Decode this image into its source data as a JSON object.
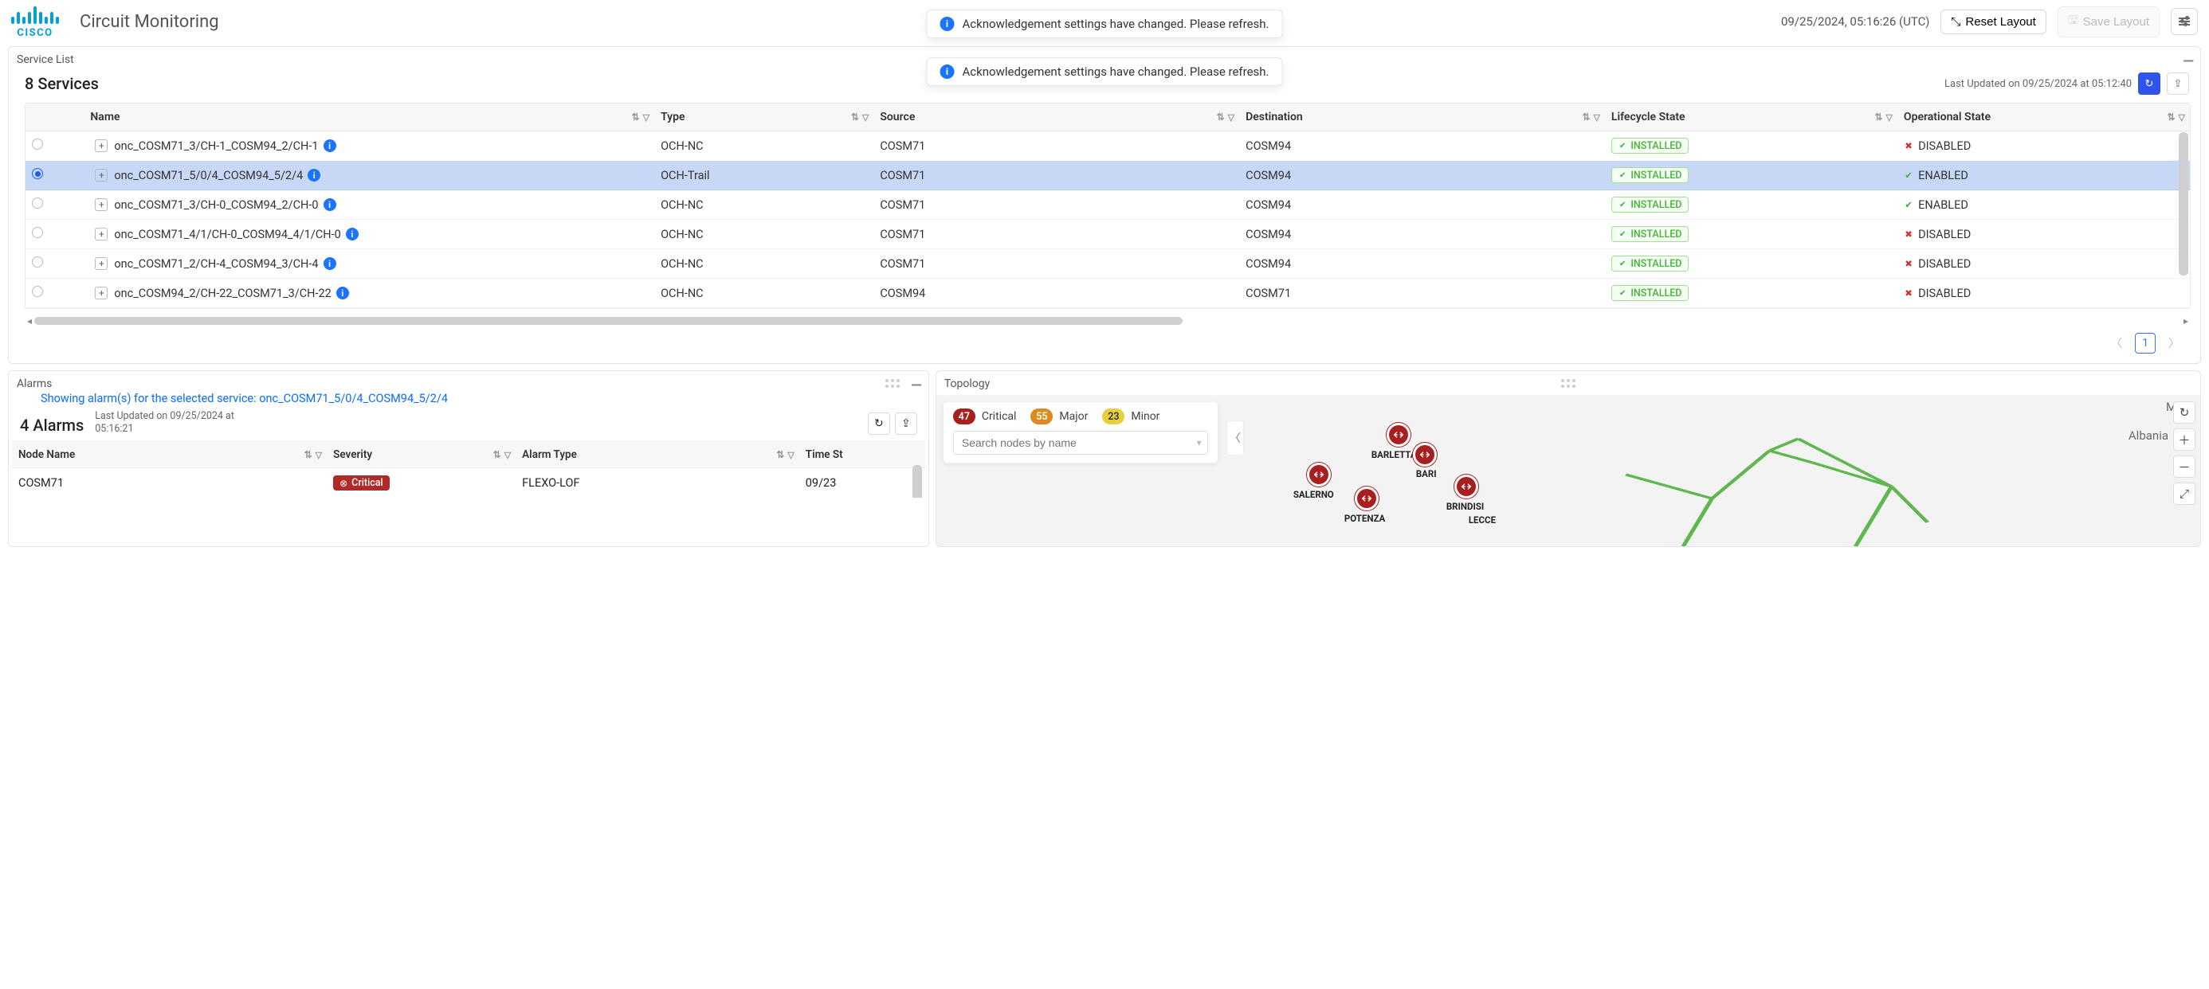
{
  "app": {
    "title": "Circuit Monitoring",
    "vendor": "cisco"
  },
  "toast": {
    "message": "Acknowledgement settings have changed. Please refresh."
  },
  "header": {
    "timestamp": "09/25/2024, 05:16:26 (UTC)",
    "reset_label": "Reset Layout",
    "save_label": "Save Layout"
  },
  "service_list": {
    "panel_title": "Service List",
    "count_label": "8 Services",
    "last_updated": "Last Updated on 09/25/2024 at 05:12:40",
    "columns": {
      "name": "Name",
      "type": "Type",
      "source": "Source",
      "destination": "Destination",
      "lifecycle": "Lifecycle State",
      "operational": "Operational State"
    },
    "rows": [
      {
        "selected": false,
        "name": "onc_COSM71_3/CH-1_COSM94_2/CH-1",
        "type": "OCH-NC",
        "source": "COSM71",
        "destination": "COSM94",
        "lifecycle": "INSTALLED",
        "operational": "DISABLED",
        "op_ok": false
      },
      {
        "selected": true,
        "name": "onc_COSM71_5/0/4_COSM94_5/2/4",
        "type": "OCH-Trail",
        "source": "COSM71",
        "destination": "COSM94",
        "lifecycle": "INSTALLED",
        "operational": "ENABLED",
        "op_ok": true
      },
      {
        "selected": false,
        "name": "onc_COSM71_3/CH-0_COSM94_2/CH-0",
        "type": "OCH-NC",
        "source": "COSM71",
        "destination": "COSM94",
        "lifecycle": "INSTALLED",
        "operational": "ENABLED",
        "op_ok": true
      },
      {
        "selected": false,
        "name": "onc_COSM71_4/1/CH-0_COSM94_4/1/CH-0",
        "type": "OCH-NC",
        "source": "COSM71",
        "destination": "COSM94",
        "lifecycle": "INSTALLED",
        "operational": "DISABLED",
        "op_ok": false
      },
      {
        "selected": false,
        "name": "onc_COSM71_2/CH-4_COSM94_3/CH-4",
        "type": "OCH-NC",
        "source": "COSM71",
        "destination": "COSM94",
        "lifecycle": "INSTALLED",
        "operational": "DISABLED",
        "op_ok": false
      },
      {
        "selected": false,
        "name": "onc_COSM94_2/CH-22_COSM71_3/CH-22",
        "type": "OCH-NC",
        "source": "COSM94",
        "destination": "COSM71",
        "lifecycle": "INSTALLED",
        "operational": "DISABLED",
        "op_ok": false
      }
    ],
    "page": "1"
  },
  "alarms": {
    "panel_title": "Alarms",
    "context_prefix": "Showing alarm(s) for the selected service: ",
    "context_service": "onc_COSM71_5/0/4_COSM94_5/2/4",
    "count_label": "4 Alarms",
    "last_updated": "Last Updated on 09/25/2024 at 05:16:21",
    "columns": {
      "node": "Node Name",
      "severity": "Severity",
      "type": "Alarm Type",
      "time": "Time St"
    },
    "rows": [
      {
        "node": "COSM71",
        "severity": "Critical",
        "type": "FLEXO-LOF",
        "time": "09/23"
      }
    ]
  },
  "topology": {
    "panel_title": "Topology",
    "legend": {
      "critical": {
        "count": "47",
        "label": "Critical"
      },
      "major": {
        "count": "55",
        "label": "Major"
      },
      "minor": {
        "count": "23",
        "label": "Minor"
      }
    },
    "search_placeholder": "Search nodes by name",
    "map_labels": {
      "macedonia": "Mace",
      "albania": "Albania"
    },
    "nodes": {
      "n1": "SALERNO",
      "n2": "POTENZA",
      "n3": "BARLETTA",
      "n4": "BARI",
      "n5": "BRINDISI",
      "n6": "LECCE"
    }
  }
}
